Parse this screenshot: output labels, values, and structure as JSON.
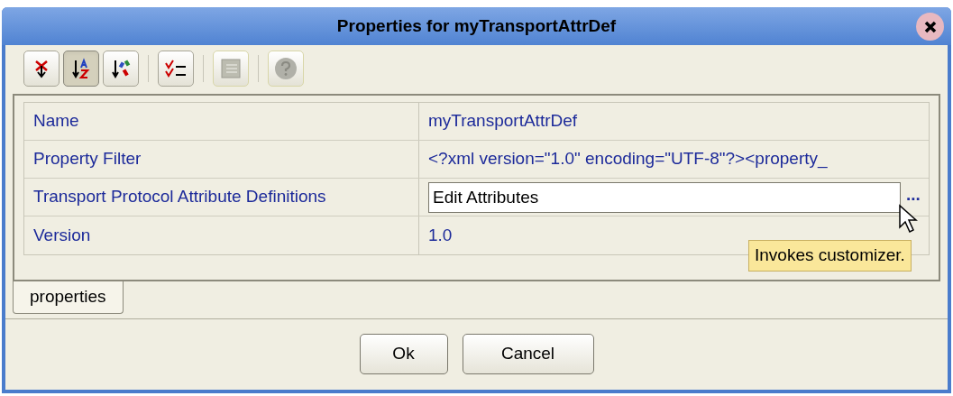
{
  "window": {
    "title": "Properties for myTransportAttrDef"
  },
  "toolbar": [
    {
      "kind": "unsort",
      "selected": false,
      "disabled": false
    },
    {
      "kind": "sort-alpha",
      "selected": true,
      "disabled": false
    },
    {
      "kind": "sort-type",
      "selected": false,
      "disabled": false
    },
    {
      "kind": "separator"
    },
    {
      "kind": "editable",
      "selected": false,
      "disabled": false
    },
    {
      "kind": "separator"
    },
    {
      "kind": "grid",
      "selected": false,
      "disabled": true
    },
    {
      "kind": "separator"
    },
    {
      "kind": "help",
      "selected": false,
      "disabled": true
    }
  ],
  "properties": [
    {
      "name": "Name",
      "kind": "text",
      "value": "myTransportAttrDef"
    },
    {
      "name": "Property Filter",
      "kind": "text",
      "value": "<?xml version=\"1.0\" encoding=\"UTF-8\"?><property_"
    },
    {
      "name": "Transport Protocol Attribute Definitions",
      "kind": "editor",
      "value": "Edit Attributes",
      "button": "..."
    },
    {
      "name": "Version",
      "kind": "text",
      "value": "1.0"
    }
  ],
  "tooltip": "Invokes customizer.",
  "tabs": [
    {
      "label": "properties",
      "selected": true
    }
  ],
  "buttons": [
    "Ok",
    "Cancel"
  ]
}
